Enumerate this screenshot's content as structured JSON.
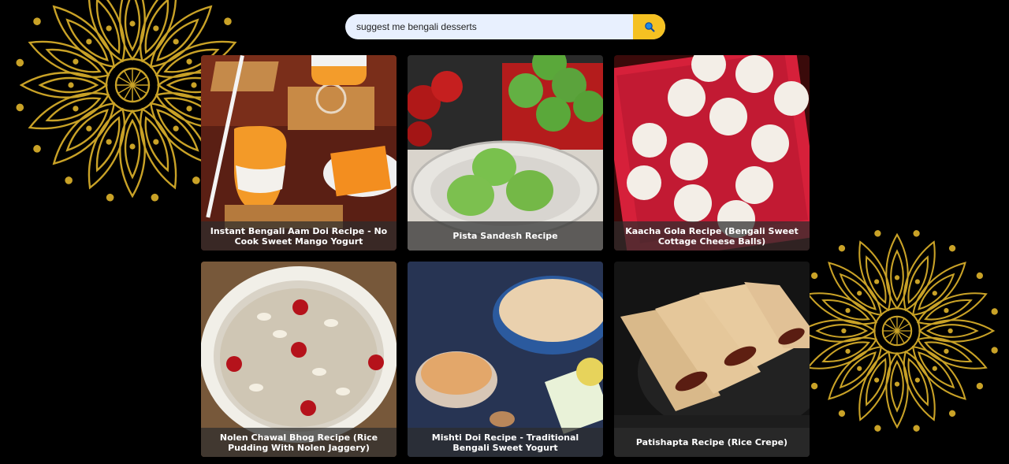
{
  "search": {
    "value": "suggest me bengali desserts",
    "button_icon": "search-icon"
  },
  "colors": {
    "background": "#000000",
    "search_field": "#e8f0fe",
    "search_button": "#f5c122",
    "mandala": "#c9a227"
  },
  "decorations": [
    "mandala-ornament",
    "mandala-ornament"
  ],
  "recipes": [
    {
      "title": "Instant Bengali Aam Doi Recipe - No Cook Sweet Mango Yogurt",
      "image": "mango yogurt in glasses"
    },
    {
      "title": "Pista Sandesh Recipe",
      "image": "green pista sandesh on glass plate"
    },
    {
      "title": "Kaacha Gola Recipe (Bengali Sweet Cottage Cheese Balls)",
      "image": "white sweet balls in red box"
    },
    {
      "title": "Nolen Chawal Bhog Recipe (Rice Pudding With Nolen Jaggery)",
      "image": "rice pudding bowl with almonds and cherries"
    },
    {
      "title": "Mishti Doi Recipe - Traditional Bengali Sweet Yogurt",
      "image": "sweet yogurt in bowls"
    },
    {
      "title": "Patishapta Recipe (Rice Crepe)",
      "image": "rolled rice crepes"
    }
  ]
}
